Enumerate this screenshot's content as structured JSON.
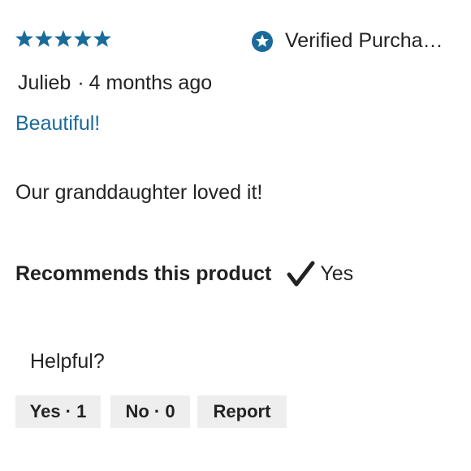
{
  "review": {
    "rating": 5,
    "rating_max": 5,
    "star_color": "#1a6b99",
    "verified_label": "Verified Purcha…",
    "author": "Julieb",
    "separator": "·",
    "posted": "4 months ago",
    "title": "Beautiful!",
    "title_color": "#1a6b99",
    "body": "Our granddaughter loved it!",
    "recommends_label": "Recommends this product",
    "recommends_value": "Yes"
  },
  "feedback": {
    "helpful_label": "Helpful?",
    "yes_label": "Yes · 1",
    "no_label": "No · 0",
    "report_label": "Report"
  }
}
